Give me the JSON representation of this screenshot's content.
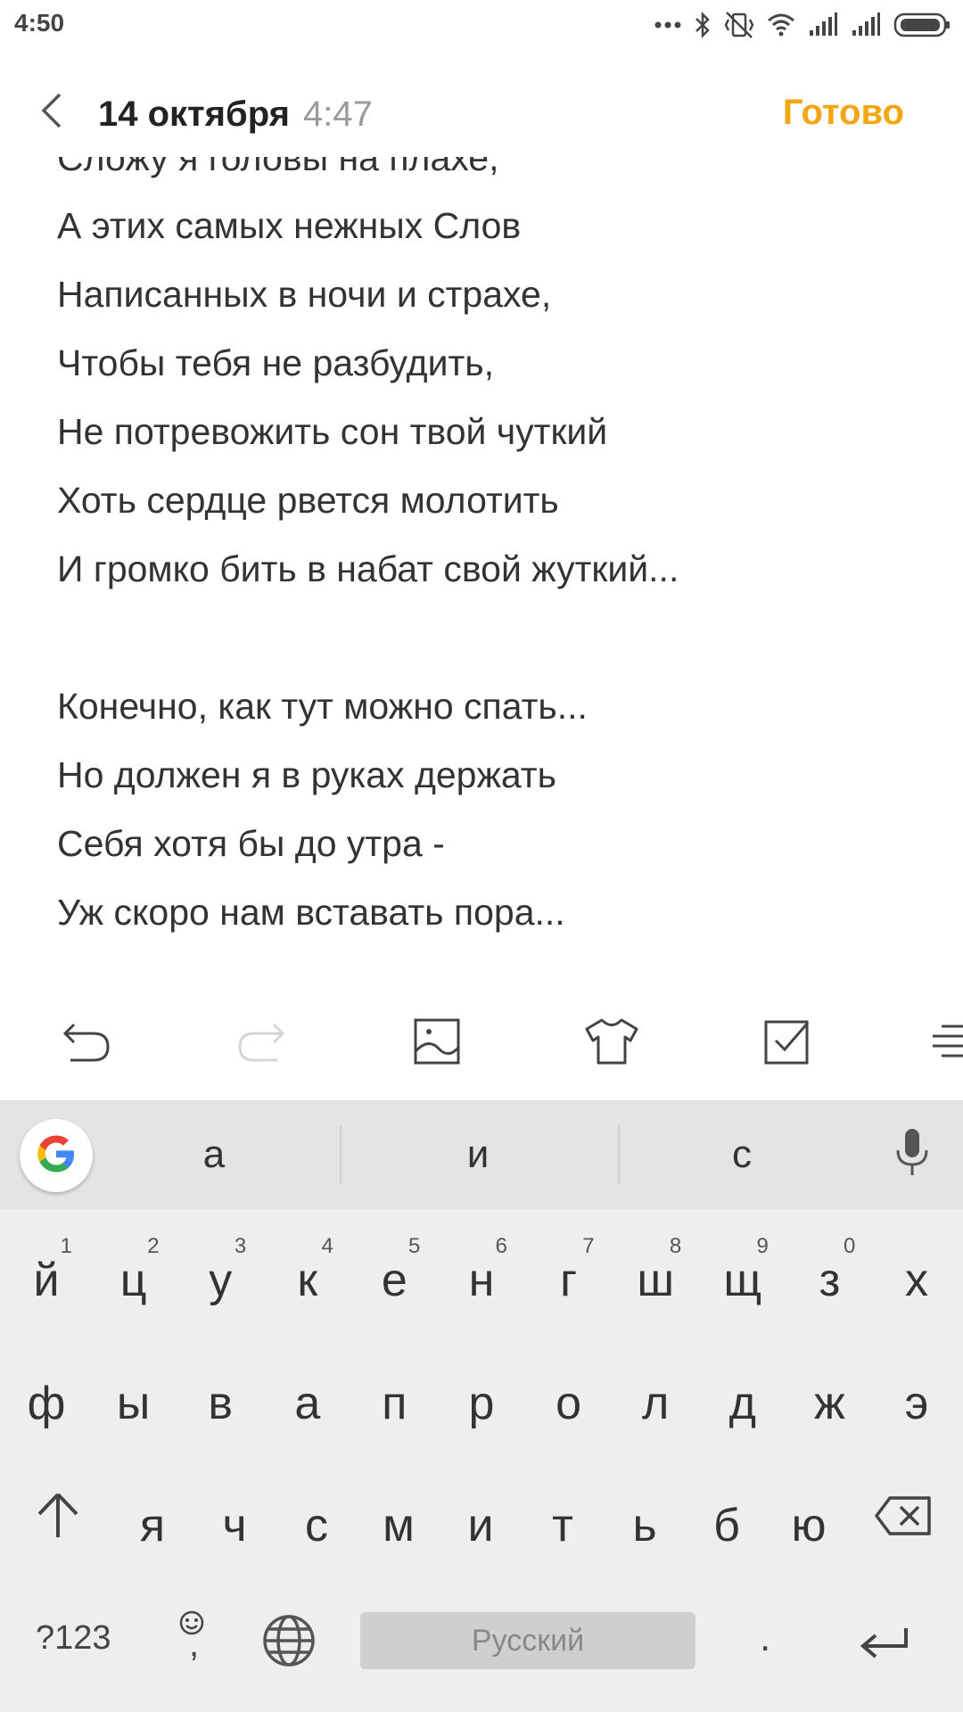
{
  "status_bar": {
    "time": "4:50",
    "icons": [
      "more-dots-icon",
      "bluetooth-icon",
      "vibrate-icon",
      "wifi-icon",
      "signal-icon",
      "signal-icon",
      "battery-icon"
    ]
  },
  "header": {
    "date": "14 октября",
    "time": "4:47",
    "done_label": "Готово",
    "accent_color": "#f3a612"
  },
  "note": {
    "lines": [
      "Сложу я головы на плахе,",
      "А этих самых нежных Слов",
      "Написанных в ночи и страхе,",
      "Чтобы тебя не разбудить,",
      "Не потревожить сон твой чуткий",
      "Хоть сердце рвется молотить",
      "И громко бить в набат свой жуткий...",
      "",
      "Конечно, как тут можно спать...",
      "Но должен я в руках держать",
      "Себя хотя бы до утра -",
      "Уж скоро нам вставать пора..."
    ]
  },
  "toolbar": {
    "icons": [
      "undo-icon",
      "redo-icon",
      "image-icon",
      "theme-shirt-icon",
      "checklist-icon",
      "format-list-icon"
    ]
  },
  "keyboard": {
    "suggestions": [
      "а",
      "и",
      "с"
    ],
    "row1": [
      "й",
      "ц",
      "у",
      "к",
      "е",
      "н",
      "г",
      "ш",
      "щ",
      "з",
      "х"
    ],
    "row1_hints": [
      "1",
      "2",
      "3",
      "4",
      "5",
      "6",
      "7",
      "8",
      "9",
      "0",
      ""
    ],
    "row2": [
      "ф",
      "ы",
      "в",
      "а",
      "п",
      "р",
      "о",
      "л",
      "д",
      "ж",
      "э"
    ],
    "row3": [
      "я",
      "ч",
      "с",
      "м",
      "и",
      "т",
      "ь",
      "б",
      "ю"
    ],
    "symbols_label": "?123",
    "emoji_comma_label": ",",
    "space_label": "Русский",
    "period_label": "."
  }
}
